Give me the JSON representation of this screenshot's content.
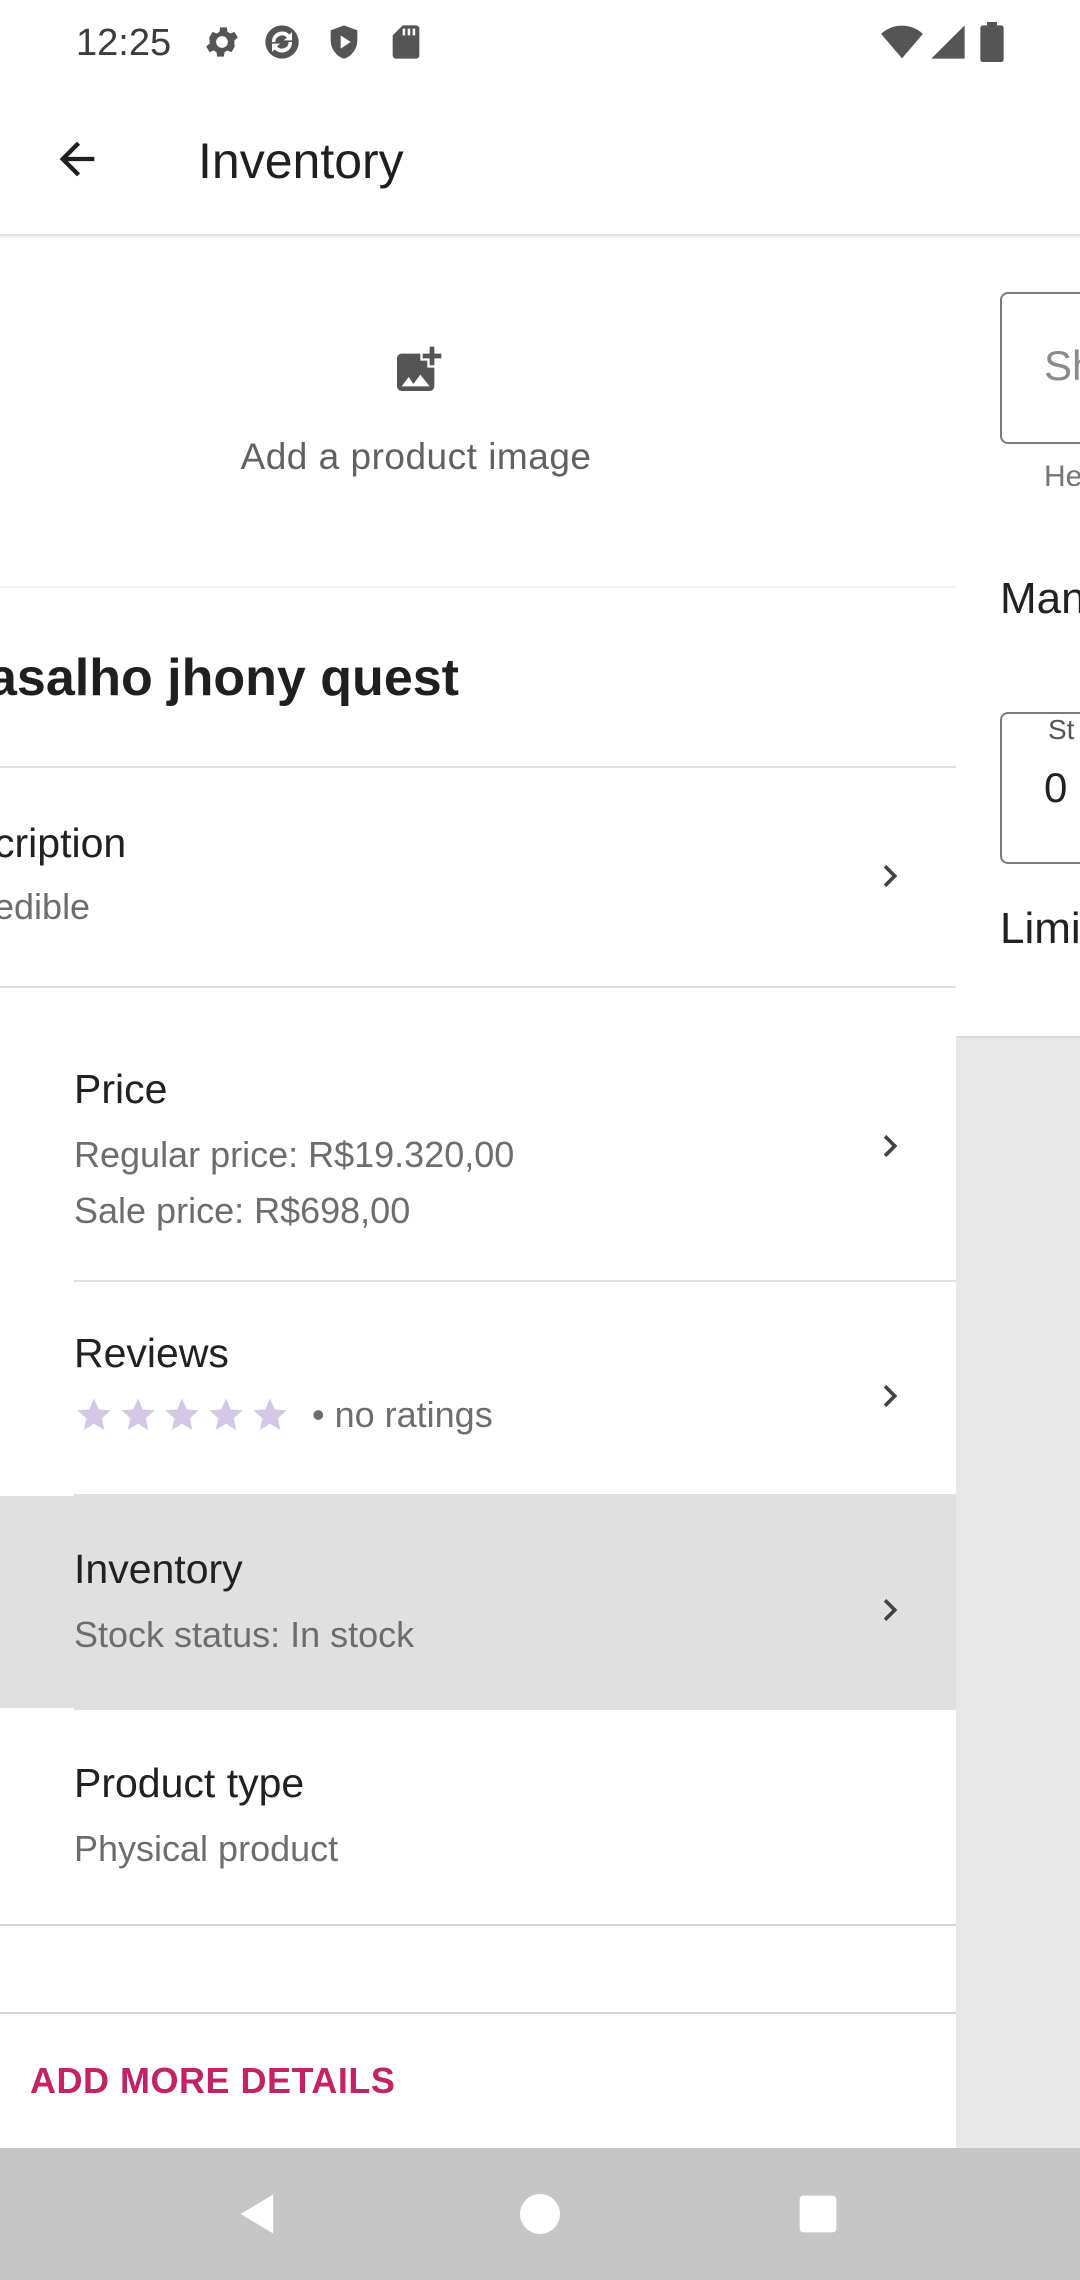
{
  "status_bar": {
    "time": "12:25",
    "icons": [
      "settings-icon",
      "sync-icon",
      "shield-icon",
      "sd-card-icon"
    ],
    "right_icons": [
      "wifi-icon",
      "signal-icon",
      "battery-icon"
    ]
  },
  "app_bar": {
    "back_icon": "arrow-back-icon",
    "title": "Inventory"
  },
  "product": {
    "add_image_label": "Add a product image",
    "name": "asalho jhony quest",
    "description_title": "cription",
    "description_value": "edible",
    "price_title": "Price",
    "regular_price": "Regular price: R$19.320,00",
    "sale_price": "Sale price: R$698,00",
    "reviews_title": "Reviews",
    "reviews_rating": 0,
    "reviews_text": "• no ratings",
    "inventory_title": "Inventory",
    "inventory_value": "Stock status: In stock",
    "product_type_title": "Product type",
    "product_type_value": "Physical product",
    "add_more_details": "ADD MORE DETAILS"
  },
  "side_panel": {
    "sku_placeholder": "Sh",
    "sku_helper": "He",
    "manage_label": "Man",
    "stock_label": "St",
    "stock_value": "0",
    "limit_label": "Limi"
  },
  "colors": {
    "accent": "#c22266",
    "star": "#d4c8e6",
    "pressed_row": "#e0e0e0"
  },
  "nav_bar": [
    "back-triangle-icon",
    "home-circle-icon",
    "recents-square-icon"
  ]
}
